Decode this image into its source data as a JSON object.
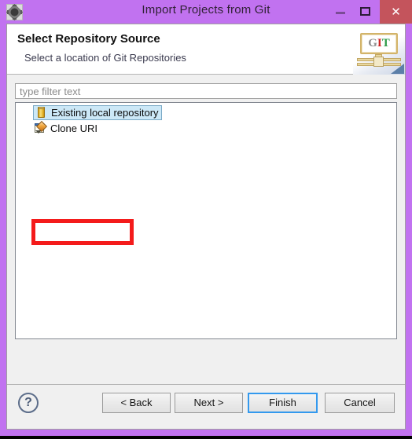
{
  "window": {
    "title": "Import Projects from Git",
    "icon": "gear-icon",
    "accent_purple": "#c172f0",
    "close_button_color": "#c4545c",
    "controls": {
      "minimize": "–",
      "maximize": "□",
      "close": "✕"
    }
  },
  "header": {
    "title": "Select Repository Source",
    "subtitle": "Select a location of Git Repositories",
    "logo": {
      "letter_g": "G",
      "letter_i": "I",
      "letter_t": "T",
      "color_g": "#8d8d8d",
      "color_i": "#cf2222",
      "color_t": "#2f9c4a"
    }
  },
  "filter": {
    "value": "",
    "placeholder": "type filter text"
  },
  "tree": {
    "items": [
      {
        "label": "Existing local repository",
        "icon": "repository-cylinder-icon",
        "selected": true
      },
      {
        "label": "Clone URI",
        "icon": "clone-uri-page-pencil-icon",
        "selected": false
      }
    ]
  },
  "annotation": {
    "shape": "rectangle",
    "color": "#f41b1b",
    "targets": "Clone URI"
  },
  "buttons": {
    "help": "?",
    "back": "< Back",
    "next": "Next >",
    "finish": "Finish",
    "cancel": "Cancel",
    "focus_color": "#3399ee"
  }
}
